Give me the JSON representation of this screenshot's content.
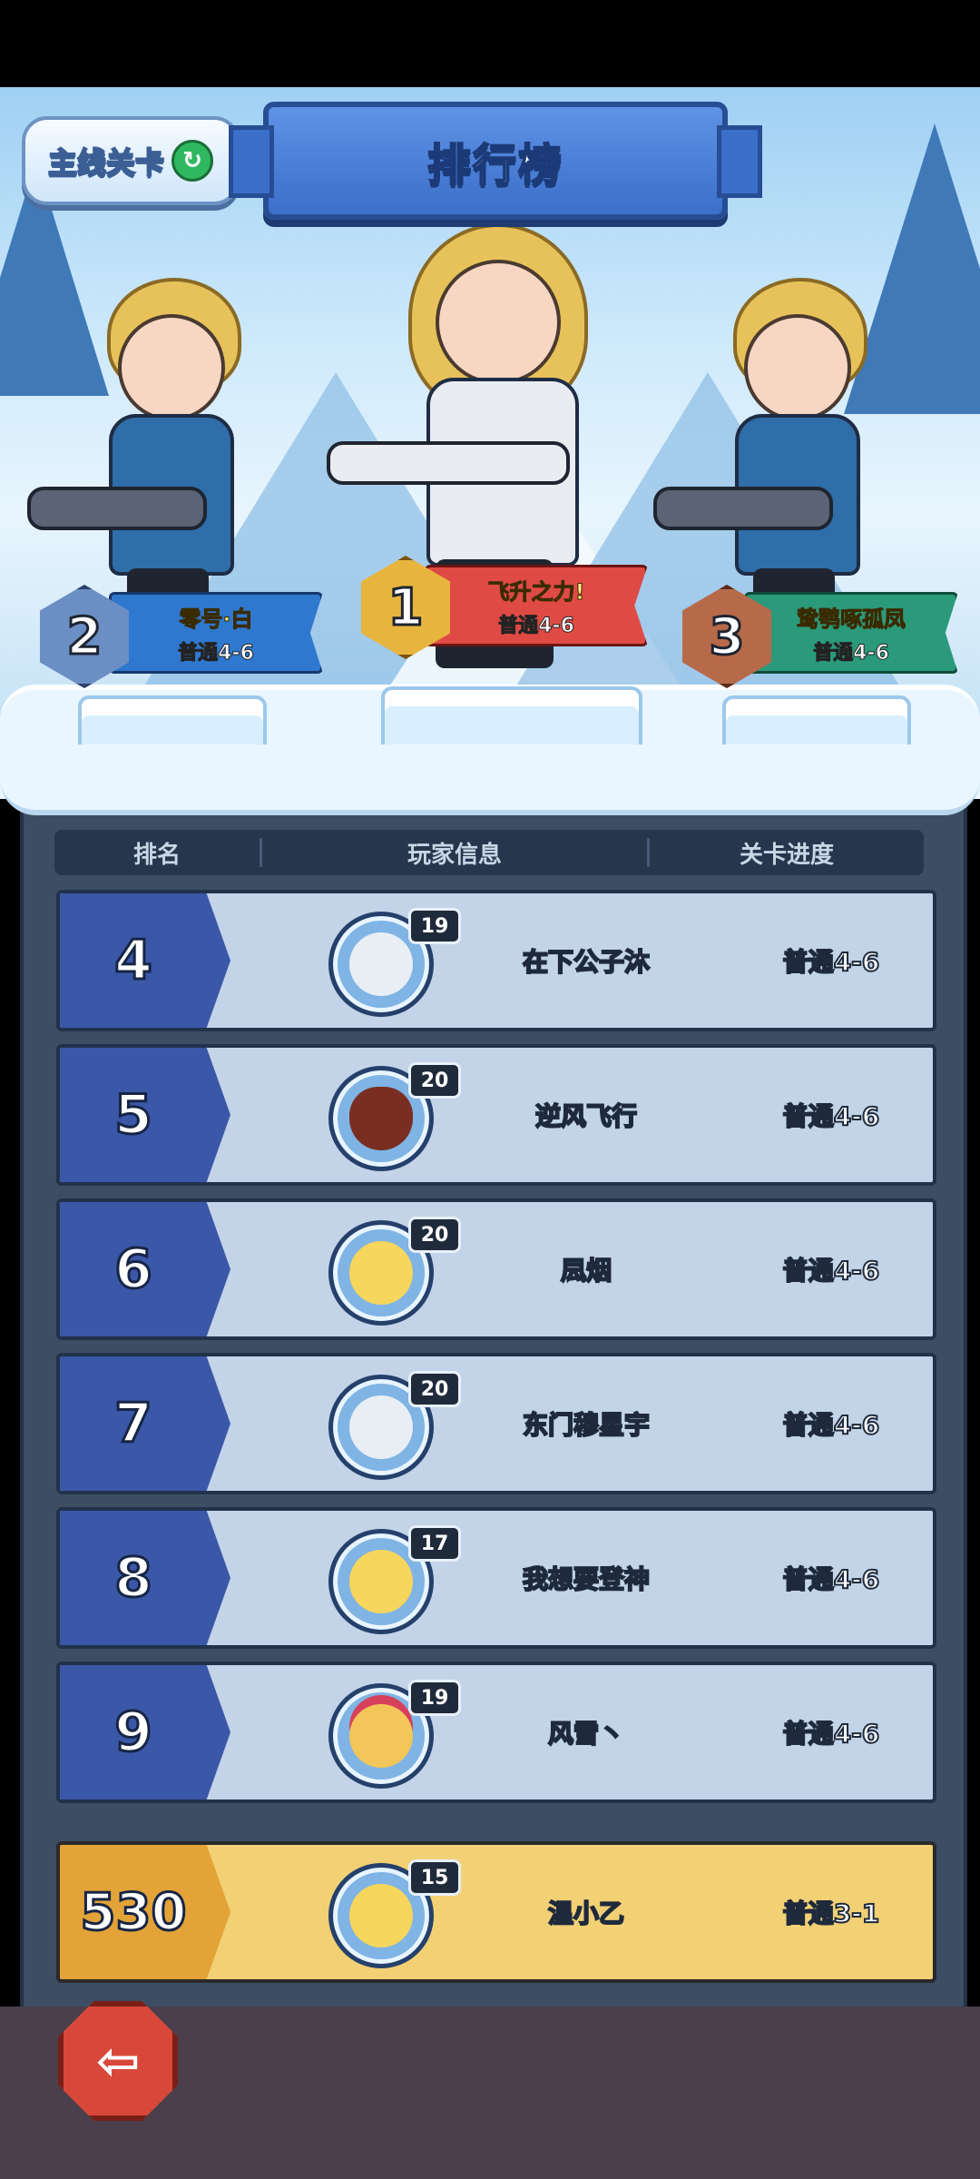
{
  "header": {
    "stage_button": "主线关卡",
    "title": "排行榜"
  },
  "podium": [
    {
      "rank": "2",
      "name": "零号·白",
      "progress": "普通4-6"
    },
    {
      "rank": "1",
      "name": "飞升之力!",
      "progress": "普通4-6"
    },
    {
      "rank": "3",
      "name": "鸷鹗啄孤凤",
      "progress": "普通4-6"
    }
  ],
  "table": {
    "columns": [
      "排名",
      "玩家信息",
      "关卡进度"
    ],
    "rows": [
      {
        "rank": "4",
        "level": "19",
        "name": "在下公子沐",
        "progress": "普通4-6"
      },
      {
        "rank": "5",
        "level": "20",
        "name": "逆风飞行",
        "progress": "普通4-6"
      },
      {
        "rank": "6",
        "level": "20",
        "name": "凨烟",
        "progress": "普通4-6"
      },
      {
        "rank": "7",
        "level": "20",
        "name": "东门穆星宇",
        "progress": "普通4-6"
      },
      {
        "rank": "8",
        "level": "17",
        "name": "我想要登神",
        "progress": "普通4-6"
      },
      {
        "rank": "9",
        "level": "19",
        "name": "风雪丶",
        "progress": "普通4-6"
      }
    ]
  },
  "my_row": {
    "rank": "530",
    "level": "15",
    "name": "温小乙",
    "progress": "普通3-1"
  },
  "icons": {
    "refresh": "refresh-icon",
    "back": "back-arrow-icon"
  },
  "colors": {
    "rank_blue": "#3b57a8",
    "my_row": "#f2d074",
    "my_rank": "#e3a338"
  }
}
